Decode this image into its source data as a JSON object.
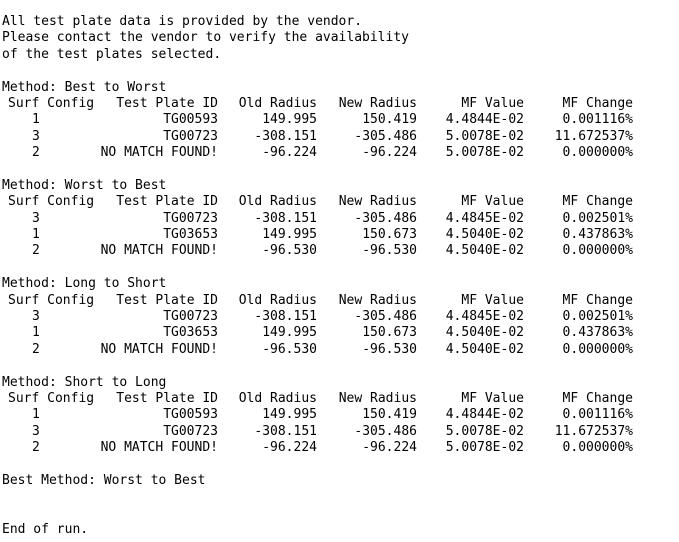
{
  "intro": [
    "All test plate data is provided by the vendor.",
    "Please contact the vendor to verify the availability",
    "of the test plates selected."
  ],
  "headers": {
    "surf_config": "Surf Config",
    "test_plate_id": "Test Plate ID",
    "old_radius": "Old Radius",
    "new_radius": "New Radius",
    "mf_value": "MF Value",
    "mf_change": "MF Change"
  },
  "methods": [
    {
      "title": "Method: Best to Worst",
      "rows": [
        {
          "surf": "1",
          "plate": "TG00593",
          "old": "149.995",
          "new": "150.419",
          "mf": "4.4844E-02",
          "change": "0.001116%"
        },
        {
          "surf": "3",
          "plate": "TG00723",
          "old": "-308.151",
          "new": "-305.486",
          "mf": "5.0078E-02",
          "change": "11.672537%"
        },
        {
          "surf": "2",
          "plate": "NO MATCH FOUND!",
          "old": "-96.224",
          "new": "-96.224",
          "mf": "5.0078E-02",
          "change": "0.000000%"
        }
      ]
    },
    {
      "title": "Method: Worst to Best",
      "rows": [
        {
          "surf": "3",
          "plate": "TG00723",
          "old": "-308.151",
          "new": "-305.486",
          "mf": "4.4845E-02",
          "change": "0.002501%"
        },
        {
          "surf": "1",
          "plate": "TG03653",
          "old": "149.995",
          "new": "150.673",
          "mf": "4.5040E-02",
          "change": "0.437863%"
        },
        {
          "surf": "2",
          "plate": "NO MATCH FOUND!",
          "old": "-96.530",
          "new": "-96.530",
          "mf": "4.5040E-02",
          "change": "0.000000%"
        }
      ]
    },
    {
      "title": "Method: Long to Short",
      "rows": [
        {
          "surf": "3",
          "plate": "TG00723",
          "old": "-308.151",
          "new": "-305.486",
          "mf": "4.4845E-02",
          "change": "0.002501%"
        },
        {
          "surf": "1",
          "plate": "TG03653",
          "old": "149.995",
          "new": "150.673",
          "mf": "4.5040E-02",
          "change": "0.437863%"
        },
        {
          "surf": "2",
          "plate": "NO MATCH FOUND!",
          "old": "-96.530",
          "new": "-96.530",
          "mf": "4.5040E-02",
          "change": "0.000000%"
        }
      ]
    },
    {
      "title": "Method: Short to Long",
      "rows": [
        {
          "surf": "1",
          "plate": "TG00593",
          "old": "149.995",
          "new": "150.419",
          "mf": "4.4844E-02",
          "change": "0.001116%"
        },
        {
          "surf": "3",
          "plate": "TG00723",
          "old": "-308.151",
          "new": "-305.486",
          "mf": "5.0078E-02",
          "change": "11.672537%"
        },
        {
          "surf": "2",
          "plate": "NO MATCH FOUND!",
          "old": "-96.224",
          "new": "-96.224",
          "mf": "5.0078E-02",
          "change": "0.000000%"
        }
      ]
    }
  ],
  "best_method": "Best Method: Worst to Best",
  "end": "End of run."
}
